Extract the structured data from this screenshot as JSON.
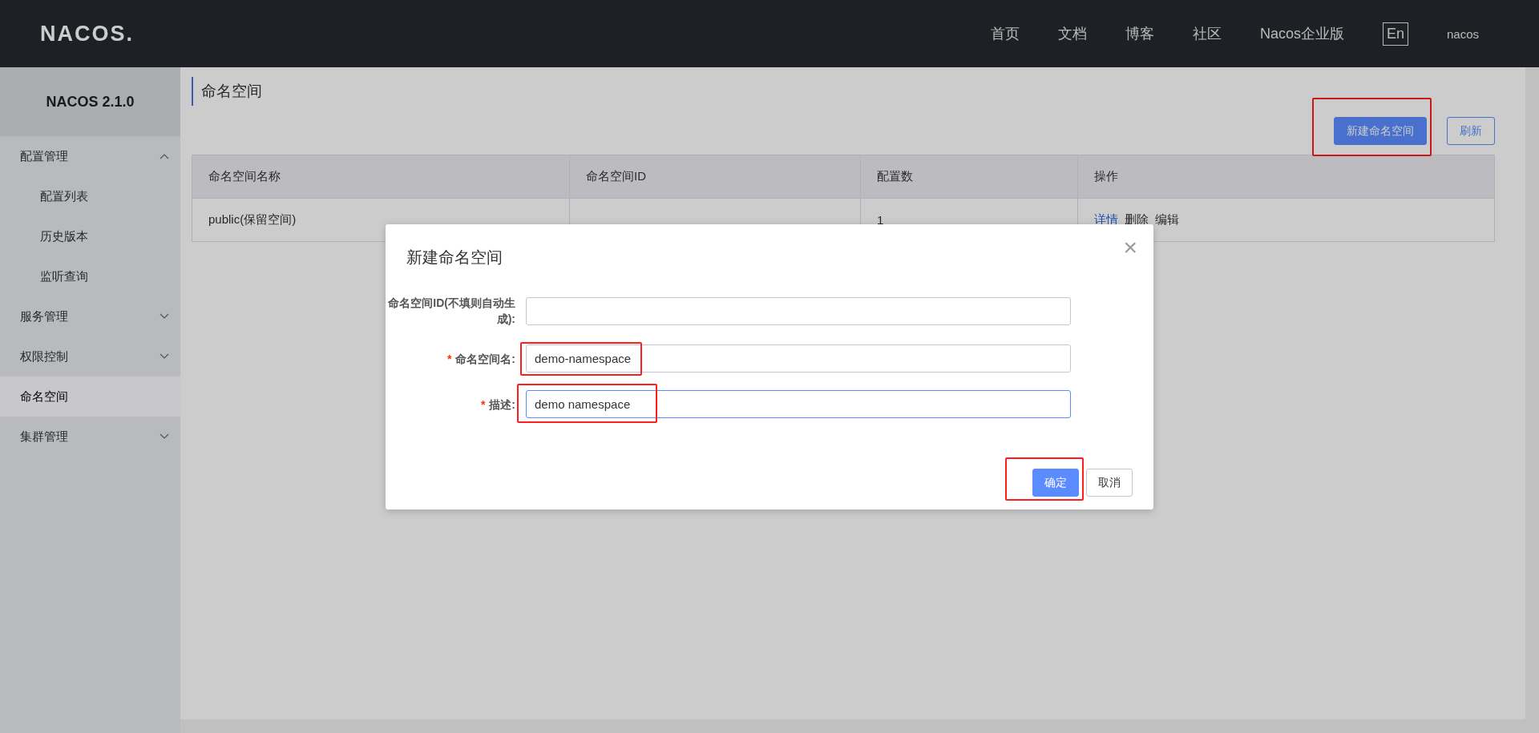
{
  "header": {
    "logo": "NACOS.",
    "nav": [
      {
        "label": "首页"
      },
      {
        "label": "文档"
      },
      {
        "label": "博客"
      },
      {
        "label": "社区"
      },
      {
        "label": "Nacos企业版"
      }
    ],
    "language": "En",
    "user": "nacos"
  },
  "sidebar": {
    "title": "NACOS 2.1.0",
    "items": [
      {
        "label": "配置管理",
        "expanded": true,
        "selected": false,
        "children": [
          {
            "label": "配置列表",
            "selected": false
          },
          {
            "label": "历史版本",
            "selected": false
          },
          {
            "label": "监听查询",
            "selected": false
          }
        ]
      },
      {
        "label": "服务管理",
        "expanded": false,
        "selected": false
      },
      {
        "label": "权限控制",
        "expanded": false,
        "selected": false
      },
      {
        "label": "命名空间",
        "selected": true
      },
      {
        "label": "集群管理",
        "expanded": false,
        "selected": false
      }
    ]
  },
  "page": {
    "title": "命名空间",
    "buttons": [
      {
        "label": "新建命名空间",
        "kind": "primary",
        "annotated": true
      },
      {
        "label": "刷新",
        "kind": "outline"
      }
    ]
  },
  "table": {
    "columns": [
      "命名空间名称",
      "命名空间ID",
      "配置数",
      "操作"
    ],
    "rows": [
      {
        "name": "public(保留空间)",
        "count": "1",
        "actions": [
          {
            "label": "详情",
            "kind": "link"
          },
          {
            "label": "删除",
            "kind": "text"
          },
          {
            "label": "编辑",
            "kind": "text"
          }
        ]
      }
    ]
  },
  "dialog": {
    "title": "新建命名空间",
    "close": "×",
    "fields": [
      {
        "label": "命名空间ID(不填则自动生成):",
        "focused": false
      },
      {
        "required_mark": "*",
        "label": "命名空间名:",
        "value": "demo-namespace",
        "focused": false,
        "annotated": true
      },
      {
        "required_mark": "*",
        "label": "描述:",
        "value": "demo namespace",
        "focused": true,
        "annotated": true
      }
    ],
    "buttons": [
      {
        "label": "确定",
        "kind": "primary",
        "annotated": true
      },
      {
        "label": "取消",
        "kind": "secondary"
      }
    ]
  }
}
